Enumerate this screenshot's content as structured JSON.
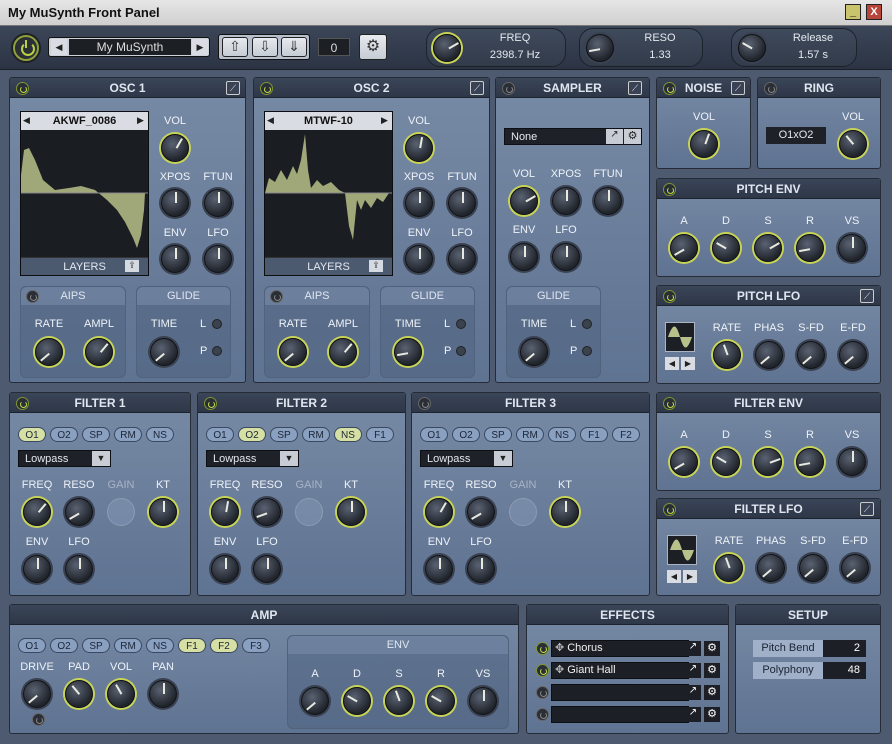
{
  "window": {
    "title": "My MuSynth Front Panel",
    "minimize_glyph": "_",
    "close_glyph": "X",
    "close_color": "#b8453a"
  },
  "topbar": {
    "preset_name": "My MuSynth",
    "counter": "0",
    "freq": {
      "label": "FREQ",
      "value": "2398.7 Hz"
    },
    "reso": {
      "label": "RESO",
      "value": "1.33"
    },
    "release": {
      "label": "Release",
      "value": "1.57 s"
    }
  },
  "osc1": {
    "title": "OSC 1",
    "wave": "AKWF_0086",
    "layers": "LAYERS",
    "vol": "VOL",
    "xpos": "XPOS",
    "ftun": "FTUN",
    "env": "ENV",
    "lfo": "LFO",
    "aips": {
      "title": "AIPS",
      "rate": "RATE",
      "ampl": "AMPL"
    },
    "glide": {
      "title": "GLIDE",
      "time": "TIME",
      "l": "L",
      "p": "P"
    }
  },
  "osc2": {
    "title": "OSC 2",
    "wave": "MTWF-10",
    "layers": "LAYERS",
    "vol": "VOL",
    "xpos": "XPOS",
    "ftun": "FTUN",
    "env": "ENV",
    "lfo": "LFO",
    "aips": {
      "title": "AIPS",
      "rate": "RATE",
      "ampl": "AMPL"
    },
    "glide": {
      "title": "GLIDE",
      "time": "TIME",
      "l": "L",
      "p": "P"
    }
  },
  "sampler": {
    "title": "SAMPLER",
    "sample": "None",
    "vol": "VOL",
    "xpos": "XPOS",
    "ftun": "FTUN",
    "env": "ENV",
    "lfo": "LFO",
    "glide": {
      "title": "GLIDE",
      "time": "TIME",
      "l": "L",
      "p": "P"
    }
  },
  "noise": {
    "title": "NOISE",
    "vol": "VOL"
  },
  "ring": {
    "title": "RING",
    "source": "O1xO2",
    "vol": "VOL"
  },
  "pitch_env": {
    "title": "PITCH ENV",
    "a": "A",
    "d": "D",
    "s": "S",
    "r": "R",
    "vs": "VS"
  },
  "pitch_lfo": {
    "title": "PITCH LFO",
    "rate": "RATE",
    "phas": "PHAS",
    "sfd": "S-FD",
    "efd": "E-FD"
  },
  "filter1": {
    "title": "FILTER 1",
    "mode": "Lowpass",
    "pills": [
      "O1",
      "O2",
      "SP",
      "RM",
      "NS"
    ],
    "freq": "FREQ",
    "reso": "RESO",
    "gain": "GAIN",
    "kt": "KT",
    "env": "ENV",
    "lfo": "LFO"
  },
  "filter2": {
    "title": "FILTER 2",
    "mode": "Lowpass",
    "pills": [
      "O1",
      "O2",
      "SP",
      "RM",
      "NS",
      "F1"
    ],
    "freq": "FREQ",
    "reso": "RESO",
    "gain": "GAIN",
    "kt": "KT",
    "env": "ENV",
    "lfo": "LFO"
  },
  "filter3": {
    "title": "FILTER 3",
    "mode": "Lowpass",
    "pills": [
      "O1",
      "O2",
      "SP",
      "RM",
      "NS",
      "F1",
      "F2"
    ],
    "freq": "FREQ",
    "reso": "RESO",
    "gain": "GAIN",
    "kt": "KT",
    "env": "ENV",
    "lfo": "LFO"
  },
  "filter_env": {
    "title": "FILTER ENV",
    "a": "A",
    "d": "D",
    "s": "S",
    "r": "R",
    "vs": "VS"
  },
  "filter_lfo": {
    "title": "FILTER LFO",
    "rate": "RATE",
    "phas": "PHAS",
    "sfd": "S-FD",
    "efd": "E-FD"
  },
  "amp": {
    "title": "AMP",
    "pills": [
      "O1",
      "O2",
      "SP",
      "RM",
      "NS",
      "F1",
      "F2",
      "F3"
    ],
    "drive": "DRIVE",
    "pad": "PAD",
    "vol": "VOL",
    "pan": "PAN",
    "env": {
      "title": "ENV",
      "a": "A",
      "d": "D",
      "s": "S",
      "r": "R",
      "vs": "VS"
    }
  },
  "effects": {
    "title": "EFFECTS",
    "slots": [
      "Chorus",
      "Giant Hall",
      "",
      ""
    ]
  },
  "setup": {
    "title": "SETUP",
    "pitch_bend_label": "Pitch Bend",
    "pitch_bend": "2",
    "polyphony_label": "Polyphony",
    "polyphony": "48"
  }
}
